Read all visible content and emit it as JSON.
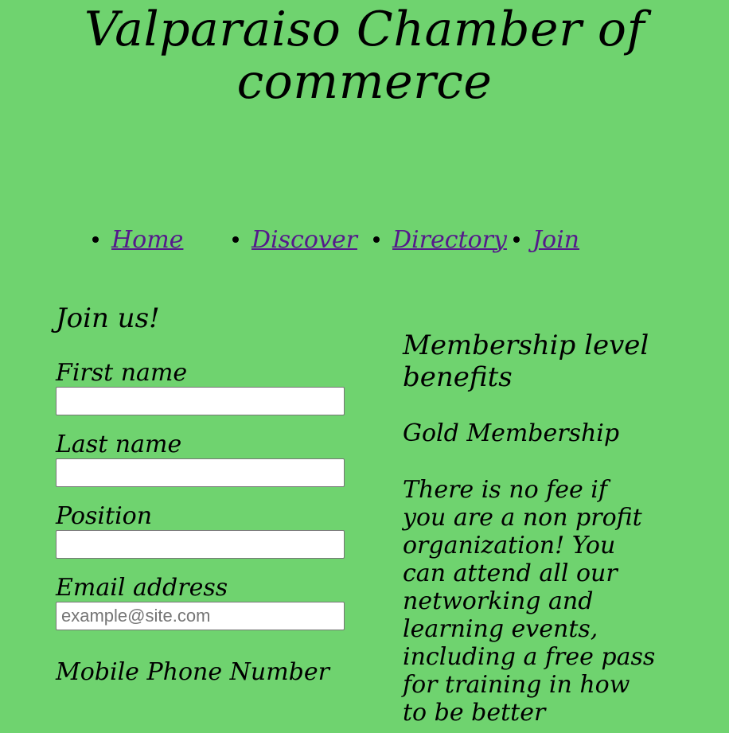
{
  "header": {
    "title": "Valparaiso Chamber of commerce"
  },
  "nav": {
    "items": [
      {
        "label": "Home"
      },
      {
        "label": "Discover"
      },
      {
        "label": "Directory"
      },
      {
        "label": "Join"
      }
    ]
  },
  "form": {
    "heading": "Join us!",
    "fields": [
      {
        "label": "First name",
        "value": "",
        "placeholder": ""
      },
      {
        "label": "Last name",
        "value": "",
        "placeholder": ""
      },
      {
        "label": "Position",
        "value": "",
        "placeholder": ""
      },
      {
        "label": "Email address",
        "value": "",
        "placeholder": "example@site.com"
      },
      {
        "label": "Mobile Phone Number"
      }
    ]
  },
  "benefits": {
    "heading": "Membership level benefits",
    "tier_name": "Gold Membership",
    "tier_description": "There is no fee if you are a non profit organization! You can attend all our networking and learning events, including a free pass for training in how to be better"
  },
  "colors": {
    "background": "#6fd36f",
    "link": "#551a8b"
  }
}
